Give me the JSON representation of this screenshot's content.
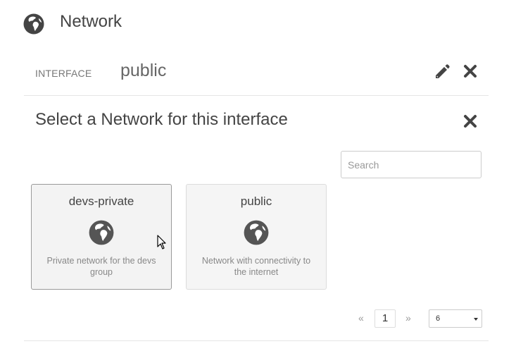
{
  "header": {
    "title": "Network",
    "icon": "globe-icon"
  },
  "interface": {
    "label": "INTERFACE",
    "value": "public",
    "edit_icon": "pencil-icon",
    "close_icon": "close-icon"
  },
  "selector": {
    "title": "Select a Network for this interface",
    "close_icon": "close-icon",
    "search": {
      "placeholder": "Search",
      "value": ""
    },
    "networks": [
      {
        "name": "devs-private",
        "description": "Private network for the devs group",
        "icon": "globe-icon",
        "selected": true
      },
      {
        "name": "public",
        "description": "Network with connectivity to the internet",
        "icon": "globe-icon",
        "selected": false
      }
    ],
    "pagination": {
      "prev": "«",
      "current": "1",
      "next": "»",
      "page_size": "6"
    }
  },
  "colors": {
    "icon": "#444444",
    "card_bg": "#f5f5f5",
    "text": "#444444",
    "muted": "#888888"
  }
}
